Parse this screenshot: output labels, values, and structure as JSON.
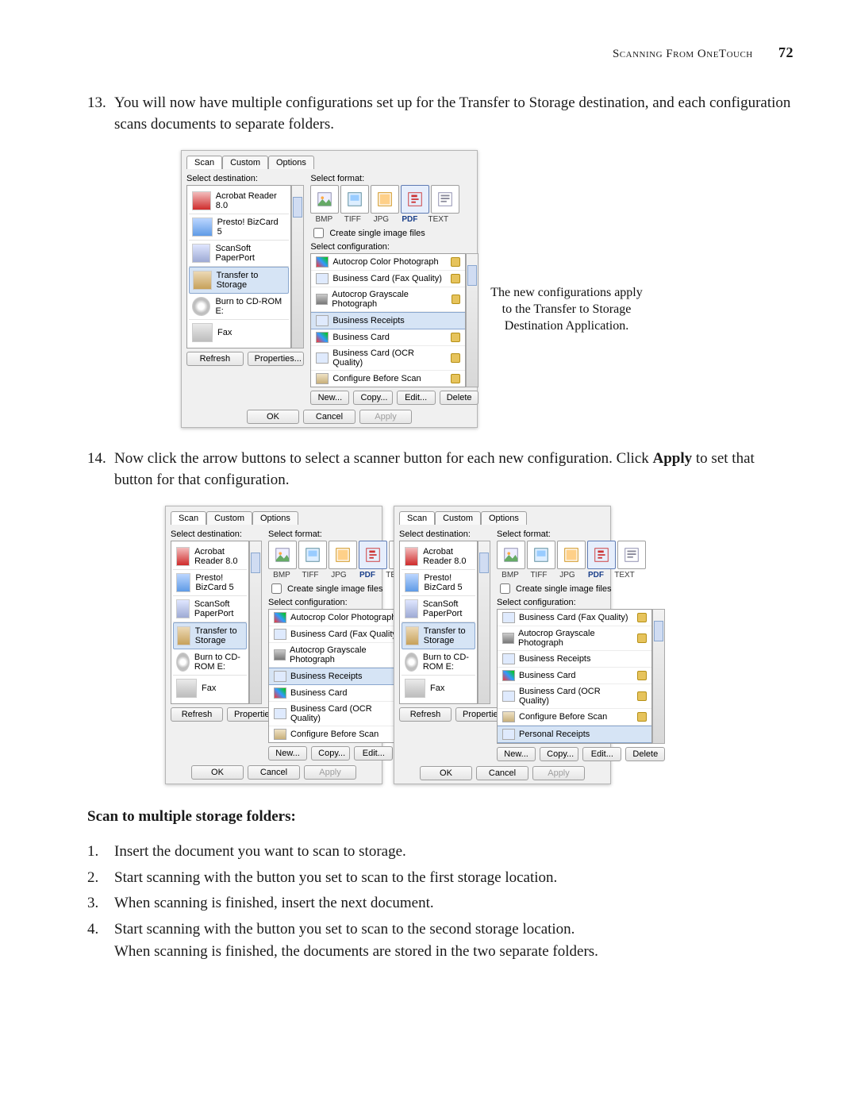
{
  "header": {
    "title": "Scanning From OneTouch",
    "page": "72"
  },
  "step13": {
    "num": "13.",
    "text": "You will now have multiple configurations set up for the Transfer to Storage destination, and each configuration scans documents to separate folders."
  },
  "dialog_main": {
    "tabs": [
      "Scan",
      "Custom",
      "Options"
    ],
    "dest_label": "Select destination:",
    "fmt_label": "Select format:",
    "cfg_label": "Select configuration:",
    "destinations": [
      {
        "name": "Acrobat Reader 8.0",
        "icon": "pdf"
      },
      {
        "name": "Presto! BizCard 5",
        "icon": "biz"
      },
      {
        "name": "ScanSoft PaperPort",
        "icon": "pc"
      },
      {
        "name": "Transfer to Storage",
        "icon": "cab",
        "selected": true
      },
      {
        "name": "Burn to CD-ROM  E:",
        "icon": "cd"
      },
      {
        "name": "Fax",
        "icon": "fax"
      }
    ],
    "formats": [
      {
        "code": "BMP"
      },
      {
        "code": "TIFF"
      },
      {
        "code": "JPG"
      },
      {
        "code": "PDF",
        "selected": true
      },
      {
        "code": "TEXT"
      }
    ],
    "create_single": "Create single image files",
    "configs": [
      {
        "name": "Autocrop Color Photograph",
        "icon": "c1",
        "lock": true
      },
      {
        "name": "Business Card (Fax Quality)",
        "icon": "c2",
        "lock": true
      },
      {
        "name": "Autocrop Grayscale Photograph",
        "icon": "c3",
        "lock": true
      },
      {
        "name": "Business Receipts",
        "icon": "c2",
        "selected": true
      },
      {
        "name": "Business Card",
        "icon": "c1",
        "lock": true
      },
      {
        "name": "Business Card (OCR Quality)",
        "icon": "c2",
        "lock": true
      },
      {
        "name": "Configure Before Scan",
        "icon": "c4",
        "lock": true
      }
    ],
    "dest_buttons": [
      "Refresh",
      "Properties..."
    ],
    "cfg_buttons": [
      "New...",
      "Copy...",
      "Edit...",
      "Delete"
    ],
    "bottom_buttons": [
      "OK",
      "Cancel",
      "Apply"
    ]
  },
  "callout_main": "The new configurations apply to the Transfer to Storage Destination Application.",
  "step14": {
    "num": "14.",
    "pre": "Now click the arrow buttons to select a scanner button for each new configuration. Click ",
    "bold": "Apply",
    "post": " to set that button for that configuration."
  },
  "dialog_small_right_extra_config": "Personal Receipts",
  "subhead": "Scan to multiple storage folders:",
  "steps": [
    {
      "n": "1.",
      "t": "Insert the document you want to scan to storage."
    },
    {
      "n": "2.",
      "t": "Start scanning with the button you set to scan to the first storage location."
    },
    {
      "n": "3.",
      "t": "When scanning is finished, insert the next document."
    },
    {
      "n": "4.",
      "t": "Start scanning with the button you set to scan to the second storage location.",
      "extra": "When scanning is finished, the documents are stored in the two separate folders."
    }
  ]
}
